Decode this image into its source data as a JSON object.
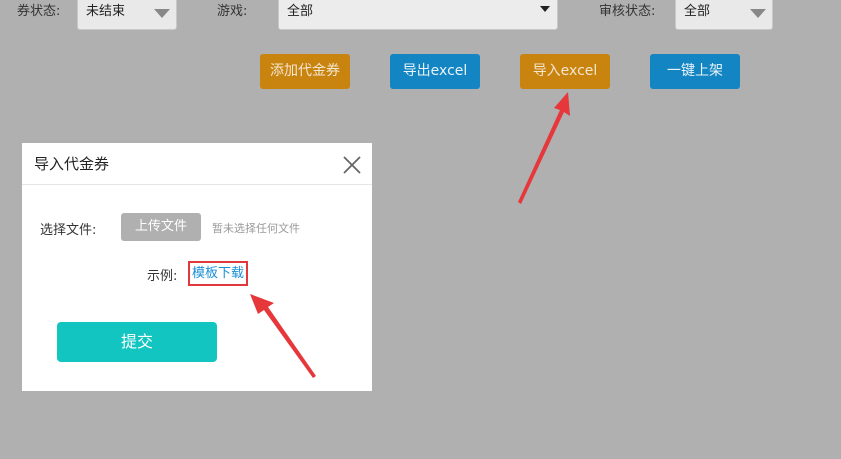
{
  "filters": {
    "coupon_status": {
      "label": "券状态:",
      "value": "未结束"
    },
    "game": {
      "label": "游戏:",
      "value": "全部"
    },
    "review_status": {
      "label": "审核状态:",
      "value": "全部"
    }
  },
  "toolbar": {
    "add_coupon": "添加代金券",
    "export_excel": "导出excel",
    "import_excel": "导入excel",
    "one_click_list": "一键上架"
  },
  "modal": {
    "title": "导入代金券",
    "file_label": "选择文件:",
    "upload_label": "上传文件",
    "no_file_text": "暂未选择任何文件",
    "example_label": "示例:",
    "template_link": "模板下载",
    "submit_label": "提交"
  },
  "colors": {
    "orange_button": "#c98410",
    "blue_button": "#1485c3",
    "submit_button": "#12c5c0",
    "highlight": "#e0383c",
    "link": "#1a8fd6"
  }
}
